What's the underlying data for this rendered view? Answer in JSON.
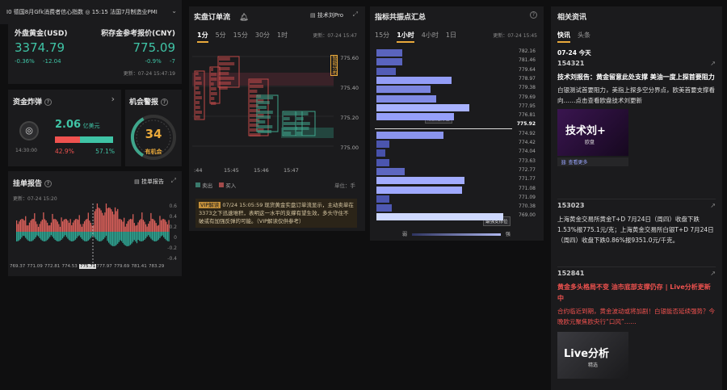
{
  "ticker": {
    "text": "I0 德国8月Gfk消费者信心指数 ◎ 15:15 法国7月制造业PMI"
  },
  "gold": {
    "title_usd": "外盘黄金(USD)",
    "title_cny": "积存金参考报价(CNY)",
    "price_usd": "3374.79",
    "pct_usd": "-0.36%",
    "chg_usd": "-12.04",
    "price_cny": "775.09",
    "pct_cny": "-0.9%",
    "chg_cny": "-7",
    "updated": "更新：07-24 15:47:19"
  },
  "bomb": {
    "title": "资金炸弹",
    "time": "14:30:00",
    "amount": "2.06",
    "unit": "亿美元",
    "left_pct": "42.9%",
    "right_pct": "57.1%",
    "left_fraction": 0.429
  },
  "alert": {
    "title": "机会警报",
    "count": "34",
    "label": "有机会"
  },
  "order_report": {
    "title": "挂单报告",
    "button": "挂单报告",
    "updated": "更新：07-24 15:20",
    "y_ticks": [
      "0.6",
      "0.4",
      "0.2",
      "0",
      "-0.2",
      "-0.4"
    ],
    "x_ticks": [
      "769.37",
      "771.09",
      "772.81",
      "774.53",
      "775.71",
      "777.97",
      "779.69",
      "781.41",
      "783.29"
    ],
    "current": "775.71"
  },
  "flow": {
    "title": "实盘订单流",
    "button": "技术刘Pro",
    "tabs": [
      "1分",
      "5分",
      "15分",
      "30分",
      "1时"
    ],
    "active_tab": "1分",
    "updated": "更新：07-24 15:47",
    "prices": [
      "775.60",
      "775.40",
      "775.20",
      "775.00"
    ],
    "times": [
      ":44",
      "15:45",
      "15:46",
      "15:47"
    ],
    "side_label": "智能分布",
    "legend_sell": "卖出",
    "legend_buy": "买入",
    "unit": "单位：手",
    "vip_tag": "VIP解读",
    "vip_text": "07/24 15:05:59 现货黄金实盘订单流显示，主动卖单在3373之下迅速堆积，表明这一水平的支撑有望生效，多头守住不破或有加强反弹的可能。（VIP解读仅供参考）"
  },
  "resonance": {
    "title": "指标共振点汇总",
    "tabs": [
      "15分",
      "1小时",
      "4小时",
      "1日"
    ],
    "active_tab": "1小时",
    "updated": "更新：07-24 15:45",
    "levels": [
      "782.16",
      "781.46",
      "779.64",
      "778.97",
      "779.38",
      "779.69",
      "777.95",
      "776.81",
      "775.92",
      "774.92",
      "774.42",
      "774.04",
      "773.63",
      "772.77",
      "771.77",
      "771.08",
      "771.09",
      "770.38",
      "769.00"
    ],
    "current_level": "775.92",
    "resistance_label": "最强阻力位",
    "support_label": "最强支撑位",
    "weak": "弱",
    "strong": "强"
  },
  "news": {
    "title": "相关资讯",
    "tabs": [
      "快讯",
      "头条"
    ],
    "active_tab": "快讯",
    "date": "07-24 今天",
    "more": "查看更多",
    "items": [
      {
        "time": "154321",
        "headline": "技术刘报告：黄金留意此处支撑 美油一度上探首要阻力",
        "body": "白银测试首要阻力，美指上探多空分界点，欧美首要支撑看向……点击查看欧盘技术刘更新",
        "img_title": "技术刘+",
        "img_sub": "欧盘"
      },
      {
        "time": "153023",
        "headline": "",
        "body": "上海黄金交易所黄金T+D 7月24日（周四）收盘下跌1.53%报775.1元/克；上海黄金交易所白银T+D 7月24日（周四）收盘下跌0.86%报9351.0元/千克。"
      },
      {
        "time": "152841",
        "headline": "黄金多头格局不变 油市底部支撑仍存 | Live分析更新中",
        "body": "合约临近到期，黄金波动或将加剧！白银能否延续强势？今晚欧元聚焦欧央行“口风”……",
        "img_title": "Live分析",
        "img_sub": "精选"
      }
    ]
  }
}
